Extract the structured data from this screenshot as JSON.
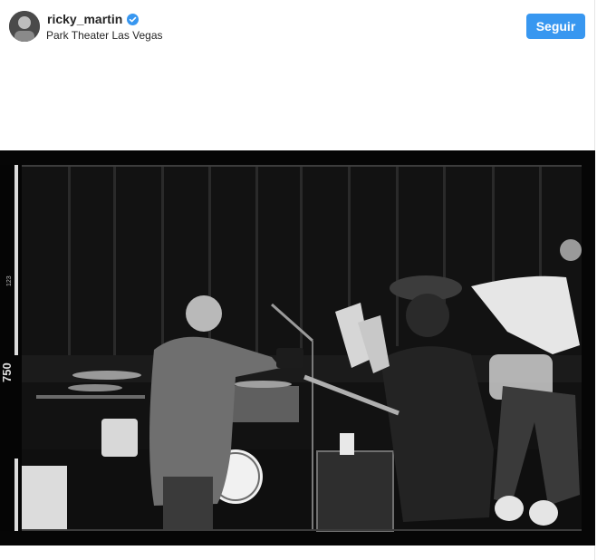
{
  "post": {
    "username": "ricky_martin",
    "verified_icon": "verified-badge-icon",
    "location": "Park Theater Las Vegas",
    "follow_label": "Seguir",
    "avatar_icon": "profile-avatar"
  },
  "photo": {
    "film_edge_number": "750",
    "film_edge_code": "123"
  },
  "colors": {
    "accent": "#3897f0",
    "text": "#262626"
  }
}
